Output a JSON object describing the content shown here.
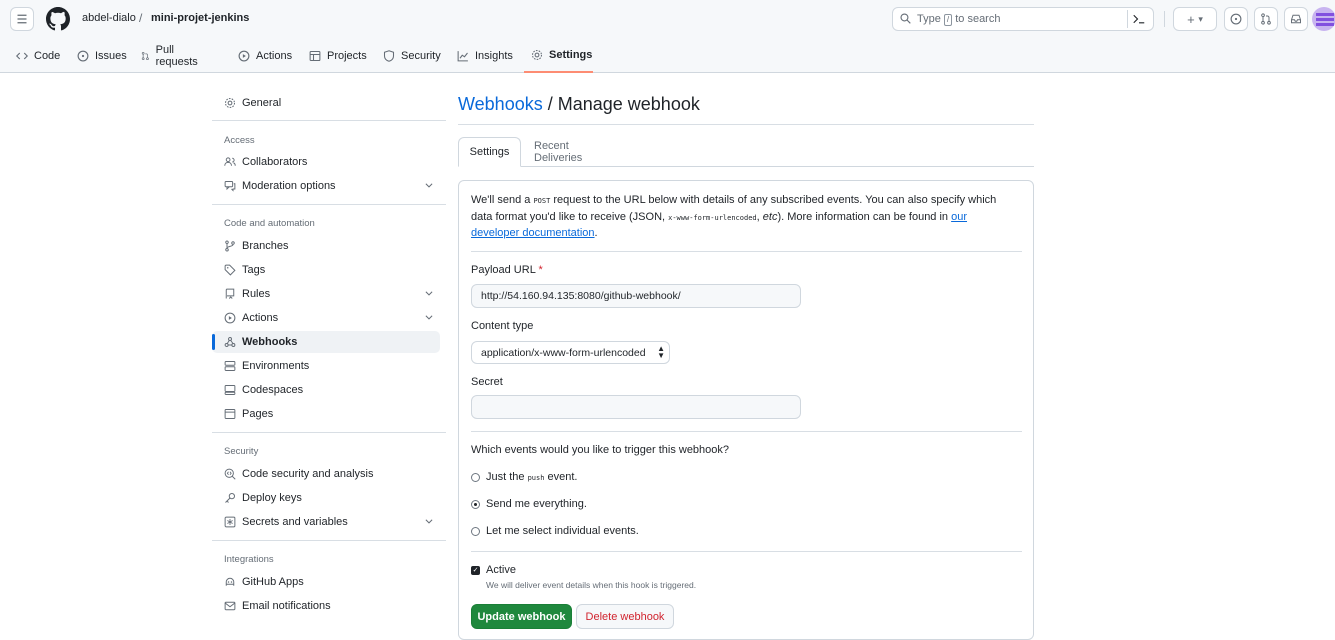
{
  "header": {
    "owner": "abdel-dialo",
    "separator": "/",
    "repo": "mini-projet-jenkins",
    "search_prefix": "Type",
    "search_key": "/",
    "search_suffix": "to search",
    "terminal_icon": "command-palette-icon",
    "plus_label": "+",
    "caret": "▾"
  },
  "repo_tabs": [
    {
      "label": "Code",
      "icon": "code-icon"
    },
    {
      "label": "Issues",
      "icon": "issue-icon"
    },
    {
      "label": "Pull requests",
      "icon": "pull-request-icon"
    },
    {
      "label": "Actions",
      "icon": "play-icon"
    },
    {
      "label": "Projects",
      "icon": "table-icon"
    },
    {
      "label": "Security",
      "icon": "shield-icon"
    },
    {
      "label": "Insights",
      "icon": "graph-icon"
    },
    {
      "label": "Settings",
      "icon": "gear-icon",
      "selected": true
    }
  ],
  "sidebar": {
    "general": "General",
    "access_heading": "Access",
    "collaborators": "Collaborators",
    "moderation": "Moderation options",
    "code_heading": "Code and automation",
    "branches": "Branches",
    "tags": "Tags",
    "rules": "Rules",
    "actions": "Actions",
    "webhooks": "Webhooks",
    "environments": "Environments",
    "codespaces": "Codespaces",
    "pages": "Pages",
    "security_heading": "Security",
    "code_security": "Code security and analysis",
    "deploy_keys": "Deploy keys",
    "secrets": "Secrets and variables",
    "integrations_heading": "Integrations",
    "github_apps": "GitHub Apps",
    "email_notifications": "Email notifications"
  },
  "main": {
    "title_link": "Webhooks",
    "title_sep": " / ",
    "title_rest": "Manage webhook",
    "tab_settings": "Settings",
    "tab_recent": "Recent Deliveries",
    "desc_1": "We'll send a ",
    "desc_post": "POST",
    "desc_2": " request to the URL below with details of any subscribed events. You can also specify which data format you'd like to receive (JSON, ",
    "desc_code": "x-www-form-urlencoded",
    "desc_3": ", ",
    "desc_etc": "etc",
    "desc_4": "). More information can be found in ",
    "desc_link": "our developer documentation",
    "desc_5": ".",
    "payload_label": "Payload URL",
    "required_mark": "*",
    "payload_value": "http://54.160.94.135:8080/github-webhook/",
    "content_type_label": "Content type",
    "content_type_value": "application/x-www-form-urlencoded",
    "secret_label": "Secret",
    "secret_value": "",
    "events_question": "Which events would you like to trigger this webhook?",
    "radio_just_1": "Just the ",
    "radio_just_code": "push",
    "radio_just_2": " event.",
    "radio_everything": "Send me everything.",
    "radio_select": "Let me select individual events.",
    "selected_radio": "everything",
    "active_label": "Active",
    "active_checked": true,
    "active_note": "We will deliver event details when this hook is triggered.",
    "update_button": "Update webhook",
    "delete_button": "Delete webhook"
  },
  "colors": {
    "accent": "#0969da",
    "selected_tab_underline": "#fd8c73",
    "primary_button": "#1f883d",
    "danger": "#d1242f"
  }
}
